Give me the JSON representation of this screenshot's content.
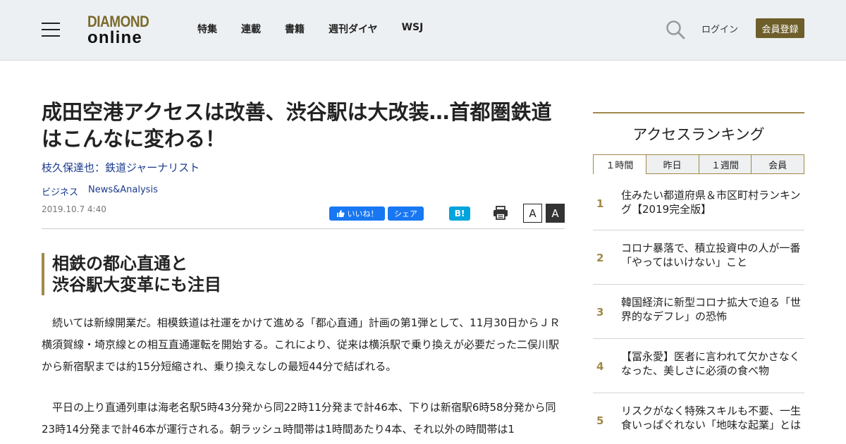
{
  "header": {
    "logo_top": "DIAMOND",
    "logo_bottom": "online",
    "nav": [
      "特集",
      "連載",
      "書籍",
      "週刊ダイヤ",
      "WSJ"
    ],
    "login_label": "ログイン",
    "signup_label": "会員登録"
  },
  "article": {
    "title": "成田空港アクセスは改善、渋谷駅は大改装…首都圏鉄道はこんなに変わる！",
    "author": "枝久保達也：鉄道ジャーナリスト",
    "categories": [
      "ビジネス",
      "News&Analysis"
    ],
    "date": "2019.10.7 4:40",
    "fb_like": "いいね！",
    "fb_share": "シェア",
    "hatena": "B!",
    "font_small": "A",
    "font_large": "A",
    "subhead_line1": "相鉄の都心直通と",
    "subhead_line2": "渋谷駅大変革にも注目",
    "para1": "　続いては新線開業だ。相模鉄道は社運をかけて進める「都心直通」計画の第1弾として、11月30日からＪＲ横須賀線・埼京線との相互直通運転を開始する。これにより、従来は横浜駅で乗り換えが必要だった二俣川駅から新宿駅までは約15分短縮され、乗り換えなしの最短44分で結ばれる。",
    "para2": "　平日の上り直通列車は海老名駅5時43分発から同22時11分発まで計46本、下りは新宿駅6時58分発から同23時14分発まで計46本が運行される。朝ラッシュ時間帯は1時間あたり4本、それ以外の時間帯は1"
  },
  "sidebar": {
    "title": "アクセスランキング",
    "tabs": [
      "１時間",
      "昨日",
      "１週間",
      "会員"
    ],
    "ranks": [
      {
        "num": "1",
        "text": "住みたい都道府県＆市区町村ランキング【2019完全版】"
      },
      {
        "num": "2",
        "text": "コロナ暴落で、積立投資中の人が一番「やってはいけない」こと"
      },
      {
        "num": "3",
        "text": "韓国経済に新型コロナ拡大で迫る「世界的なデフレ」の恐怖"
      },
      {
        "num": "4",
        "text": "【冨永愛】医者に言われて欠かさなくなった、美しさに必須の食べ物"
      },
      {
        "num": "5",
        "text": "リスクがなく特殊スキルも不要、一生食いっぱぐれない「地味な起業」とは"
      }
    ]
  },
  "colors": {
    "accent_gold": "#a0894a",
    "link_blue": "#1b3a8e",
    "facebook": "#1877f2",
    "hatena": "#00a4de"
  }
}
